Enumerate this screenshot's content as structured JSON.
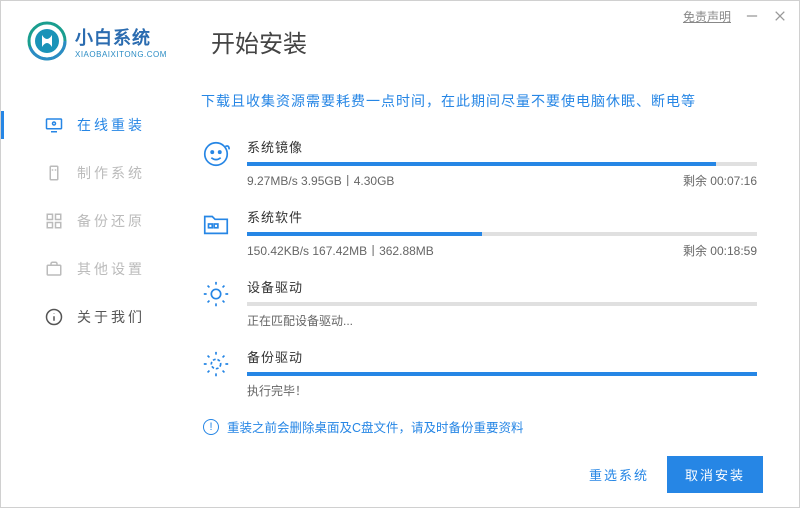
{
  "titlebar": {
    "disclaimer": "免责声明"
  },
  "brand": {
    "name": "小白系统",
    "sub": "XIAOBAIXITONG.COM"
  },
  "page_title": "开始安装",
  "sidebar": {
    "items": [
      {
        "label": "在线重装"
      },
      {
        "label": "制作系统"
      },
      {
        "label": "备份还原"
      },
      {
        "label": "其他设置"
      },
      {
        "label": "关于我们"
      }
    ]
  },
  "tip": "下载且收集资源需要耗费一点时间，在此期间尽量不要使电脑休眠、断电等",
  "tasks": [
    {
      "title": "系统镜像",
      "stats": "9.27MB/s 3.95GB丨4.30GB",
      "remain": "剩余 00:07:16",
      "progress": 92
    },
    {
      "title": "系统软件",
      "stats": "150.42KB/s 167.42MB丨362.88MB",
      "remain": "剩余 00:18:59",
      "progress": 46
    },
    {
      "title": "设备驱动",
      "status": "正在匹配设备驱动...",
      "progress": 0
    },
    {
      "title": "备份驱动",
      "status": "执行完毕！",
      "progress": 100
    }
  ],
  "warning": "重装之前会删除桌面及C盘文件，请及时备份重要资料",
  "footer": {
    "reselect": "重选系统",
    "cancel": "取消安装"
  }
}
